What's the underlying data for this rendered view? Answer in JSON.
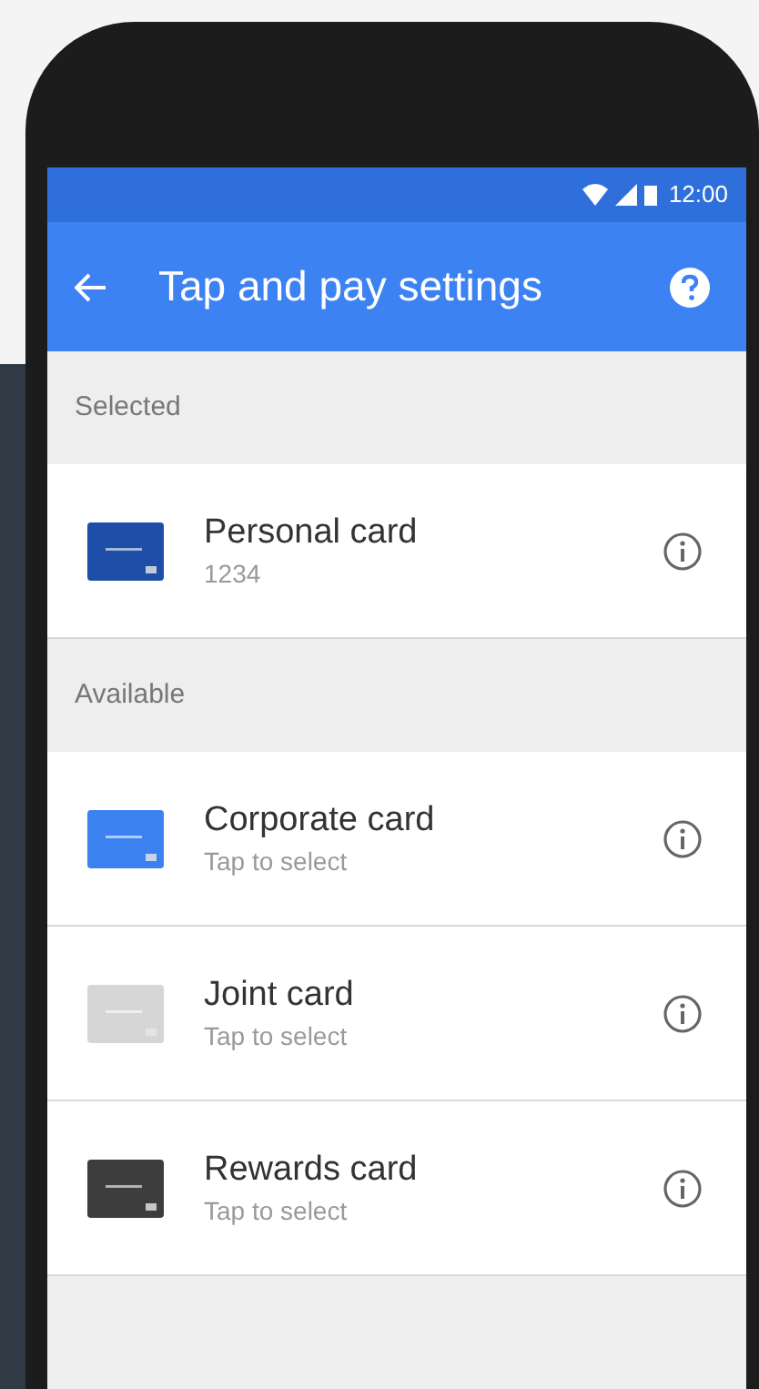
{
  "status_bar": {
    "time": "12:00"
  },
  "app_bar": {
    "title": "Tap and pay settings"
  },
  "sections": [
    {
      "header": "Selected",
      "cards": [
        {
          "name": "Personal card",
          "subtitle": "1234",
          "color": "#1e4fa8"
        }
      ]
    },
    {
      "header": "Available",
      "cards": [
        {
          "name": "Corporate card",
          "subtitle": "Tap to select",
          "color": "#3b82f0"
        },
        {
          "name": "Joint card",
          "subtitle": "Tap to select",
          "color": "#d6d6d6"
        },
        {
          "name": "Rewards card",
          "subtitle": "Tap to select",
          "color": "#3d3d3d"
        }
      ]
    }
  ]
}
